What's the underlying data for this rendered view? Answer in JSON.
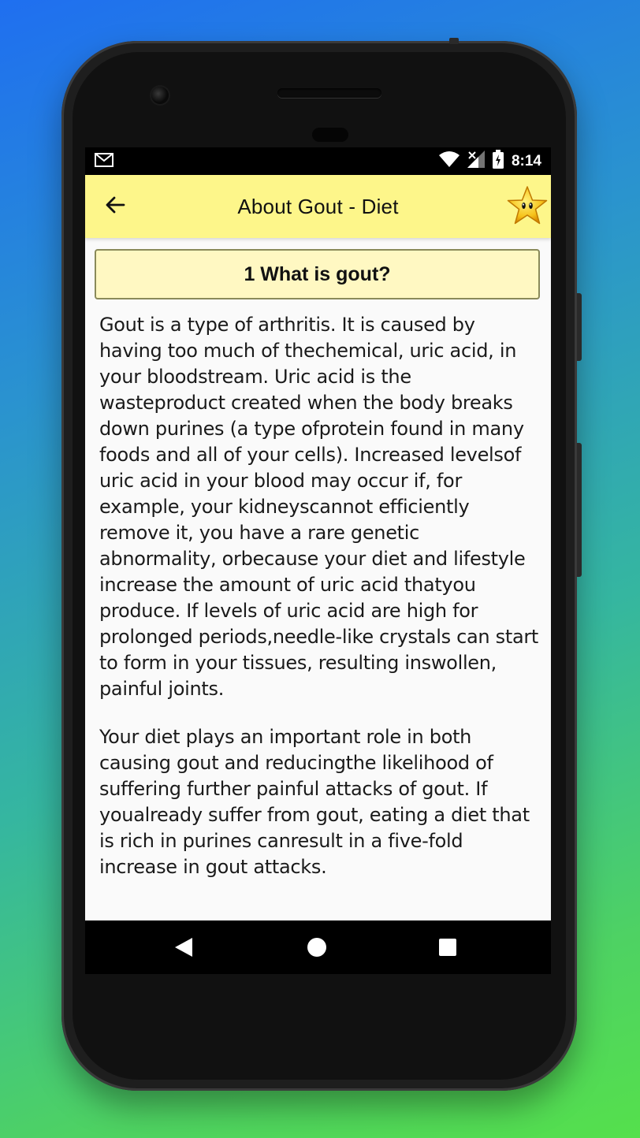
{
  "status_bar": {
    "time": "8:14",
    "icons": [
      "gmail-icon",
      "wifi-icon",
      "signal-icon",
      "battery-icon"
    ]
  },
  "app_bar": {
    "title": "About Gout - Diet",
    "back_icon": "arrow-left-icon",
    "favorite_icon": "star-icon",
    "background": "#fdf68a"
  },
  "section": {
    "header": "1 What is gout?",
    "paragraphs": [
      "Gout is a type of arthritis. It is caused by having too much of thechemical, uric acid, in your bloodstream. Uric acid is the wasteproduct created when the body breaks down purines (a type ofprotein found in many foods and all of your cells). Increased levelsof uric acid in your blood may occur if, for example, your kidneyscannot efficiently remove it, you have a rare genetic abnormality, orbecause your diet and lifestyle increase the amount of uric acid thatyou produce. If levels of uric acid are high for prolonged periods,needle-like crystals can start to form in your tissues, resulting inswollen, painful joints.",
      "Your diet plays an important role in both causing gout and reducingthe likelihood of suffering further painful attacks of gout. If youalready suffer from gout, eating a diet that is rich in purines canresult in a five-fold increase in gout attacks."
    ]
  },
  "nav_bar": {
    "icons": [
      "nav-back-icon",
      "nav-home-icon",
      "nav-recents-icon"
    ]
  }
}
